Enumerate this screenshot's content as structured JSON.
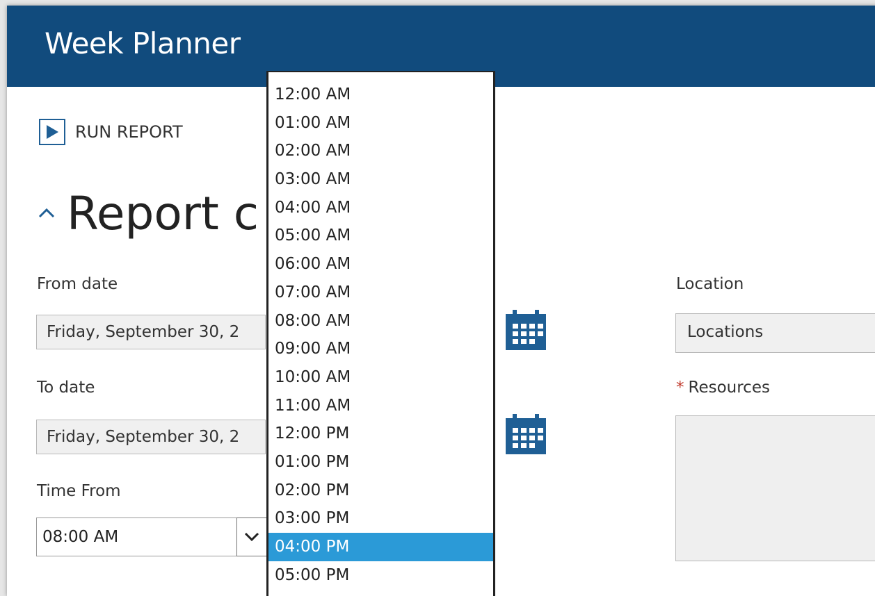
{
  "app": {
    "title": "Week Planner"
  },
  "toolbar": {
    "run_report_label": "RUN REPORT"
  },
  "section": {
    "title": "Report c"
  },
  "form": {
    "from_date": {
      "label": "From date",
      "value": "Friday, September 30, 2"
    },
    "to_date": {
      "label": "To date",
      "value": "Friday, September 30, 2"
    },
    "time_from": {
      "label": "Time From",
      "value": "08:00 AM"
    },
    "location": {
      "label": "Location",
      "value": "Locations"
    },
    "resources": {
      "required_marker": "*",
      "label": "Resources"
    }
  },
  "dropdown": {
    "selected_index": 16,
    "options": [
      "12:00 AM",
      "01:00 AM",
      "02:00 AM",
      "03:00 AM",
      "04:00 AM",
      "05:00 AM",
      "06:00 AM",
      "07:00 AM",
      "08:00 AM",
      "09:00 AM",
      "10:00 AM",
      "11:00 AM",
      "12:00 PM",
      "01:00 PM",
      "02:00 PM",
      "03:00 PM",
      "04:00 PM",
      "05:00 PM"
    ]
  },
  "colors": {
    "header_bg": "#114b7d",
    "accent": "#1f5f95",
    "selection": "#2b9ad7",
    "required": "#c0392b"
  },
  "icons": {
    "run": "play-icon",
    "collapse": "chevron-up-icon",
    "calendar": "calendar-icon",
    "select_arrow": "chevron-down-icon"
  }
}
